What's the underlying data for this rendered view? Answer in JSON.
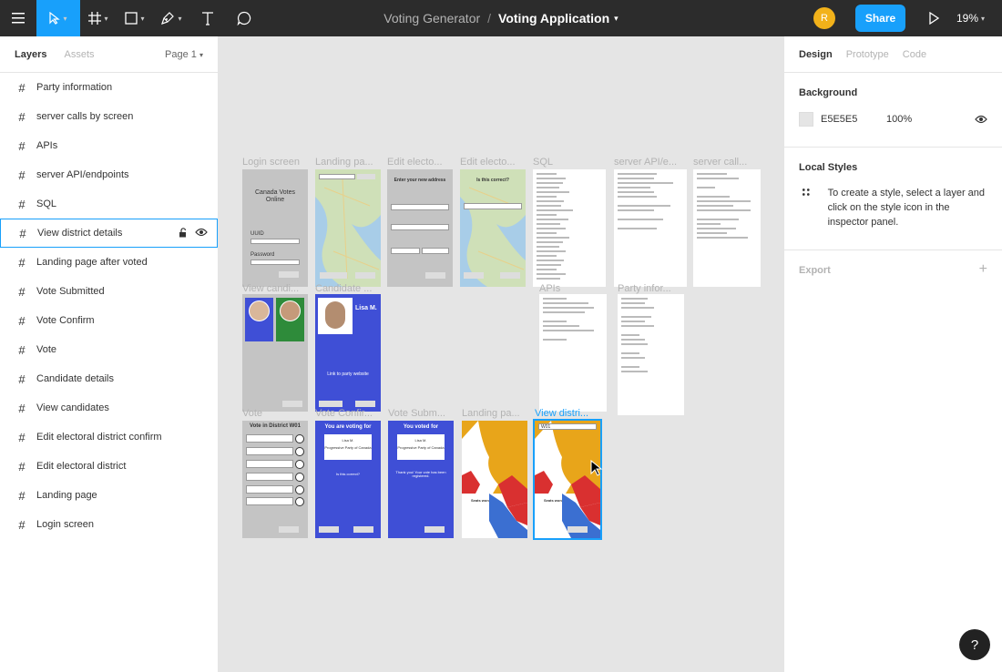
{
  "toolbar": {
    "project": "Voting Generator",
    "separator": "/",
    "file": "Voting Application",
    "avatar_initial": "R",
    "share": "Share",
    "zoom": "19%"
  },
  "left": {
    "tabs": [
      "Layers",
      "Assets"
    ],
    "page": "Page 1",
    "layers": [
      "Party information",
      "server calls by screen",
      "APIs",
      "server API/endpoints",
      "SQL",
      "View district details",
      "Landing page after voted",
      "Vote Submitted",
      "Vote Confirm",
      "Vote",
      "Candidate details",
      "View candidates",
      "Edit electoral district confirm",
      "Edit electoral district",
      "Landing page",
      "Login screen"
    ]
  },
  "canvas": {
    "labels": {
      "login": "Login screen",
      "landing": "Landing pa...",
      "edit1": "Edit electo...",
      "edit2": "Edit electo...",
      "sql": "SQL",
      "server_api": "server API/e...",
      "server_calls": "server call...",
      "view_candidates": "View candi...",
      "candidate": "Candidate ...",
      "apis": "APIs",
      "party": "Party infor...",
      "vote": "Vote",
      "vote_confirm": "Vote Confir...",
      "vote_submitted": "Vote Subm...",
      "landing_voted": "Landing pa...",
      "view_district": "View distri..."
    },
    "login_title": "Canada Votes Online",
    "login_uuid": "UUID",
    "login_password": "Password",
    "edit_title": "Enter your new address",
    "edit_confirm": "Is this correct?",
    "candidate_name": "Lisa M.",
    "candidate_link": "Link to party website",
    "vote_title": "Vote in District W01",
    "confirm_title": "You are voting for",
    "confirm_question": "Is this correct?",
    "confirm_party": "Progressive Party of Canada",
    "submitted_title": "You voted for",
    "submitted_thanks": "Thank you! Your vote has been registered.",
    "seats_label": "Seats won",
    "district_dropdown": "W01"
  },
  "right": {
    "tabs": [
      "Design",
      "Prototype",
      "Code"
    ],
    "background_heading": "Background",
    "bg_hex": "E5E5E5",
    "bg_opacity": "100%",
    "local_styles_heading": "Local Styles",
    "local_styles_text": "To create a style, select a layer and click on the style icon in the inspector panel.",
    "export_heading": "Export"
  },
  "help": "?",
  "colors": {
    "accent": "#18a0fb",
    "toolbar": "#2c2c2c",
    "canvas": "#e5e5e5",
    "frame_blue": "#3f4fd6",
    "avatar": "#f2b21a"
  }
}
